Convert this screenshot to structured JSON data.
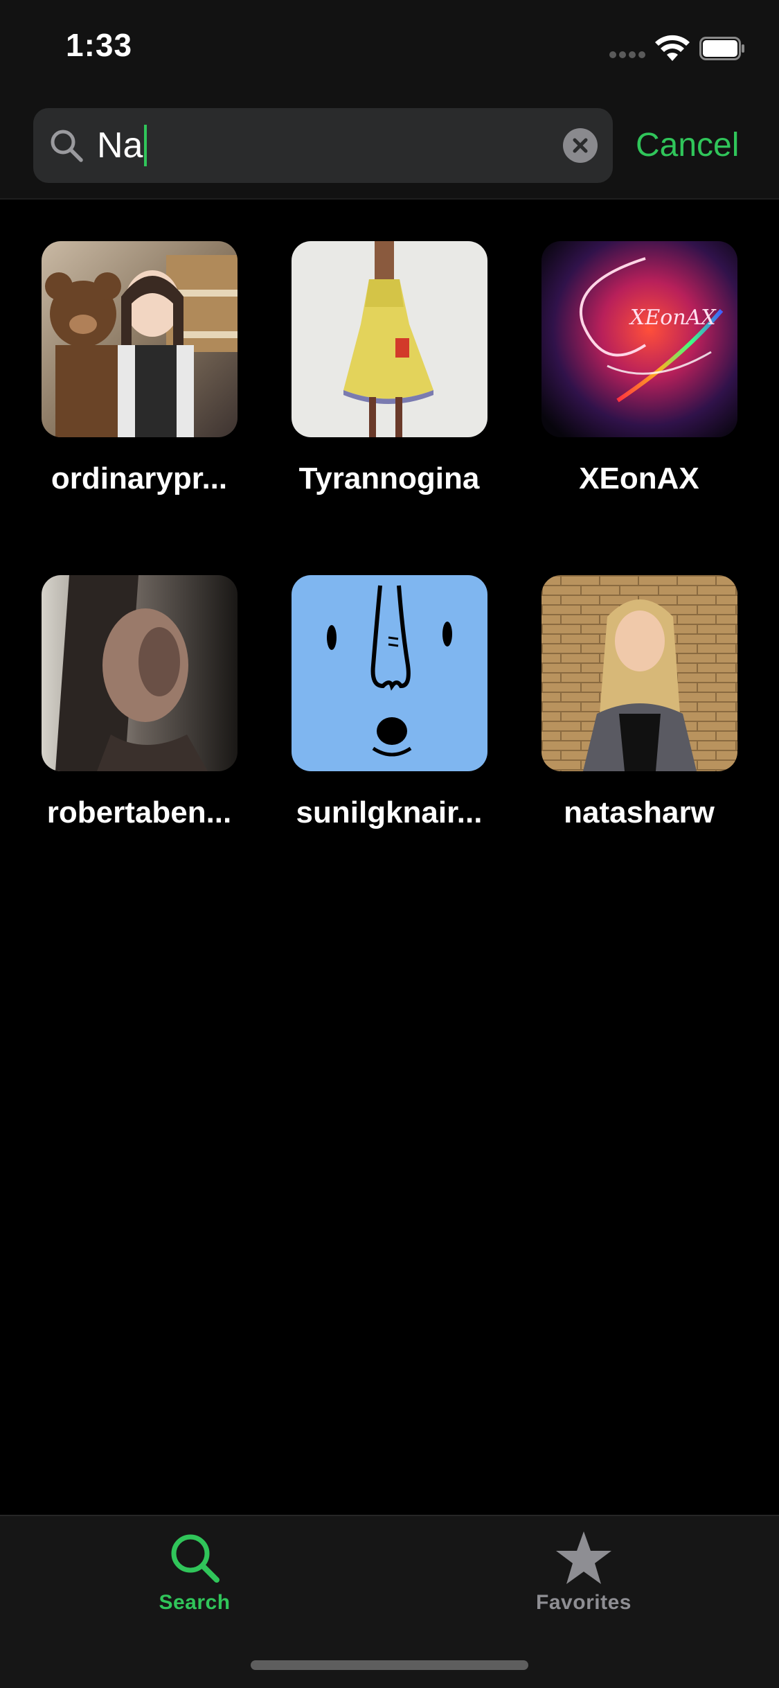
{
  "status_bar": {
    "time": "1:33"
  },
  "search": {
    "value": "Na",
    "cancel_label": "Cancel"
  },
  "results": [
    {
      "name": "ordinarypr..."
    },
    {
      "name": "Tyrannogina"
    },
    {
      "name": "XEonAX"
    },
    {
      "name": "robertaben..."
    },
    {
      "name": "sunilgknair..."
    },
    {
      "name": "natasharw"
    }
  ],
  "tab_bar": {
    "tabs": [
      {
        "label": "Search",
        "icon": "search-icon",
        "selected": true
      },
      {
        "label": "Favorites",
        "icon": "star-icon",
        "selected": false
      }
    ]
  },
  "colors": {
    "accent": "#30c55a",
    "inactive": "#8e8e93",
    "background": "#000000",
    "bar_background": "#121212",
    "search_field": "#2a2b2c"
  }
}
